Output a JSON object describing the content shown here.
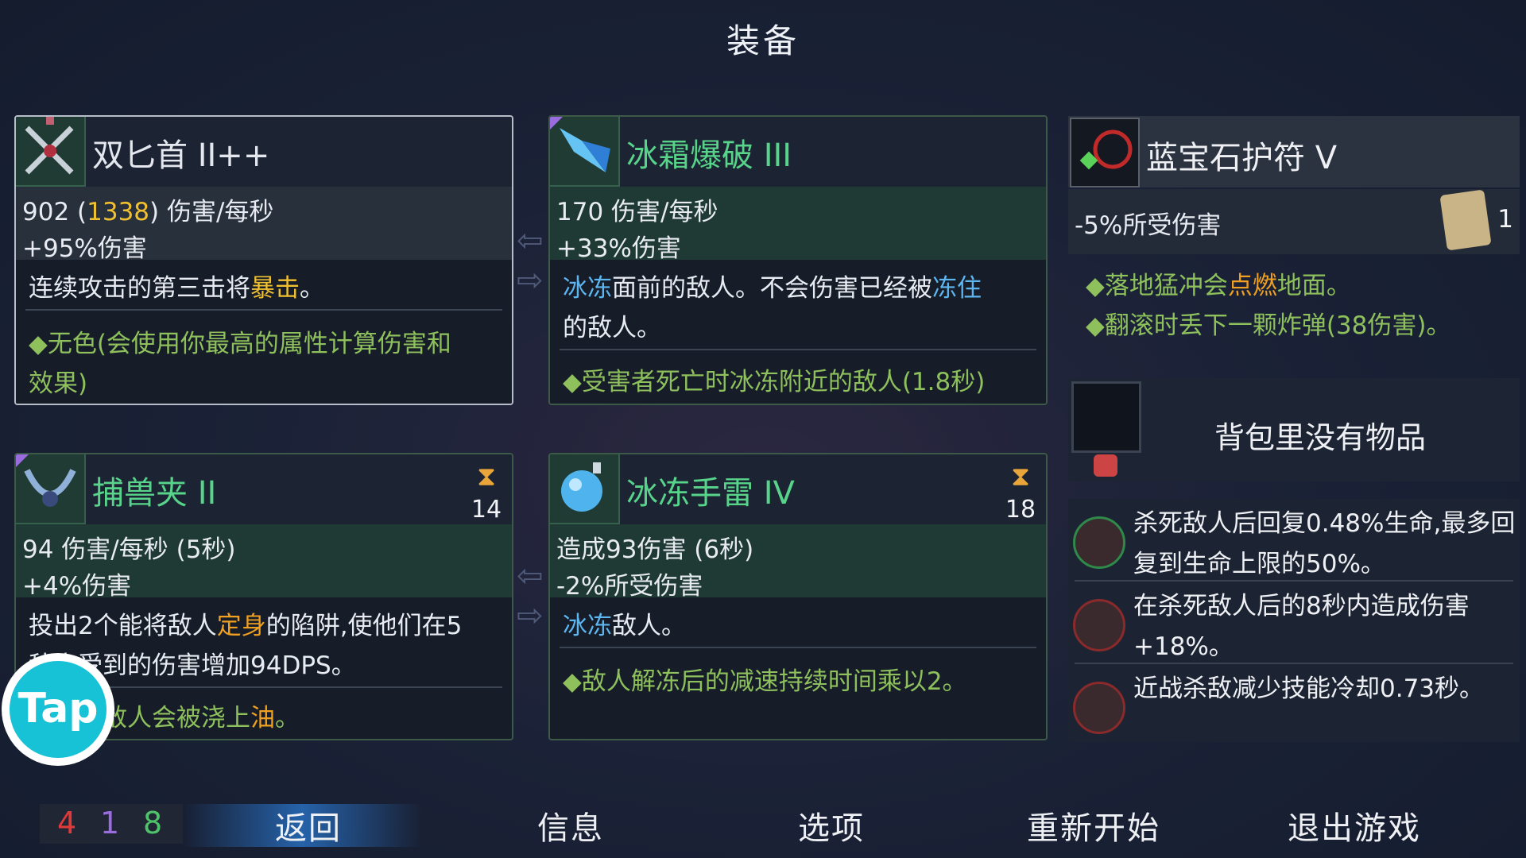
{
  "title": "装备",
  "cards": {
    "dagger": {
      "name": "双匕首 II++",
      "stat1_a": "902 (",
      "stat1_b": "1338",
      "stat1_c": ") 伤害/每秒",
      "stat2": "+95%伤害",
      "desc_a": "连续攻击的第三击将",
      "desc_b": "暴击",
      "desc_c": "。",
      "bonus1": "◆无色(会使用你最高的属性计算伤害和",
      "bonus2": "效果)"
    },
    "frost": {
      "name": "冰霜爆破 III",
      "stat1": "170 伤害/每秒",
      "stat2": "+33%伤害",
      "desc1_a": "冰冻",
      "desc1_b": "面前的敌人。不会伤害已经被",
      "desc1_c": "冻住",
      "desc2": "的敌人。",
      "bonus": "◆受害者死亡时冰冻附近的敌人(1.8秒)"
    },
    "trap": {
      "name": "捕兽夹 II",
      "cooldown": "14",
      "stat1": "94 伤害/每秒 (5秒)",
      "stat2": "+4%伤害",
      "desc1_a": "投出2个能将敌人",
      "desc1_b": "定身",
      "desc1_c": "的陷阱,使他们在5",
      "desc2": "秒内受到的伤害增加94DPS。",
      "bonus_a": "击中的敌人会被浇上",
      "bonus_b": "油",
      "bonus_c": "。"
    },
    "grenade": {
      "name": "冰冻手雷 IV",
      "cooldown": "18",
      "stat1": "造成93伤害 (6秒)",
      "stat2": "-2%所受伤害",
      "desc_a": "冰冻",
      "desc_b": "敌人。",
      "bonus": "◆敌人解冻后的减速持续时间乘以2。"
    }
  },
  "amulet": {
    "name": "蓝宝石护符 V",
    "stat": "-5%所受伤害",
    "scroll_count": "1",
    "bonus1_a": "◆落地猛冲会",
    "bonus1_b": "点燃",
    "bonus1_c": "地面。",
    "bonus2": "◆翻滚时丢下一颗炸弹(38伤害)。"
  },
  "bag": {
    "text": "背包里没有物品"
  },
  "perks": [
    {
      "text": "杀死敌人后回复0.48%生命,最多回复到生命上限的50%。"
    },
    {
      "text": "在杀死敌人后的8秒内造成伤害+18%。"
    },
    {
      "text": "近战杀敌减少技能冷却0.73秒。"
    }
  ],
  "bottom": {
    "count_red": "4",
    "count_purple": "1",
    "count_green": "8",
    "back": "返回",
    "info": "信息",
    "options": "选项",
    "restart": "重新开始",
    "quit": "退出游戏"
  },
  "overlay": {
    "tap": "Tap"
  },
  "colors": {
    "red": "#e03a3a",
    "purple": "#9a6ce0",
    "green": "#4fc36a",
    "accent": "#2e7ac4"
  }
}
